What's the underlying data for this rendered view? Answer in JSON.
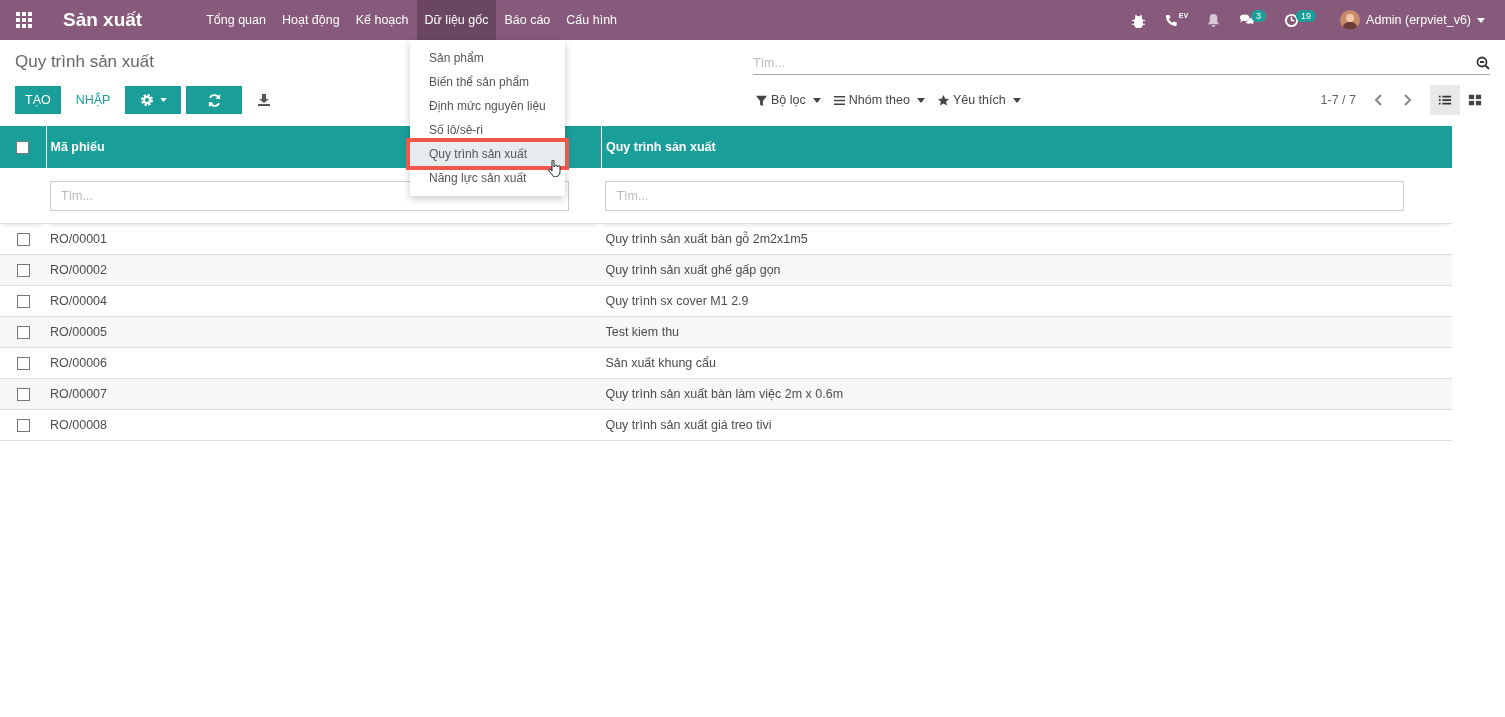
{
  "navbar": {
    "app_title": "Sản xuất",
    "menu": [
      {
        "label": "Tổng quan",
        "selected": false
      },
      {
        "label": "Hoạt động",
        "selected": false
      },
      {
        "label": "Kế hoạch",
        "selected": false
      },
      {
        "label": "Dữ liệu gốc",
        "selected": true
      },
      {
        "label": "Báo cáo",
        "selected": false
      },
      {
        "label": "Cấu hình",
        "selected": false
      }
    ],
    "systray": [
      {
        "kind": "bug"
      },
      {
        "kind": "phone",
        "tag": "EV"
      },
      {
        "kind": "bell"
      },
      {
        "kind": "chat",
        "badge": "3"
      },
      {
        "kind": "clock",
        "badge": "19"
      }
    ],
    "user": "Admin (erpviet_v6)"
  },
  "dropdown": {
    "items": [
      {
        "label": "Sản phẩm",
        "selected": false
      },
      {
        "label": "Biến thể sản phẩm",
        "selected": false
      },
      {
        "label": "Định mức nguyên liệu",
        "selected": false
      },
      {
        "label": "Số lô/sê-ri",
        "selected": false
      },
      {
        "label": "Quy trình sản xuất",
        "selected": true
      },
      {
        "label": "Năng lực sản xuất",
        "selected": false
      }
    ]
  },
  "control_panel": {
    "title": "Quy trình sản xuất",
    "create": "TẠO",
    "import": "NHẬP",
    "search_placeholder": "Tìm...",
    "filters": [
      {
        "kind": "filter",
        "label": "Bộ lọc"
      },
      {
        "kind": "group",
        "label": "Nhóm theo"
      },
      {
        "kind": "favorite",
        "label": "Yêu thích"
      }
    ],
    "pager": "1-7 / 7",
    "views": [
      {
        "kind": "list",
        "selected": true
      },
      {
        "kind": "kanban",
        "selected": false
      }
    ]
  },
  "table": {
    "select_all": false,
    "columns": [
      {
        "label": "Mã phiếu",
        "placeholder": "Tìm..."
      },
      {
        "label": "Quy trình sản xuất",
        "placeholder": "Tìm..."
      }
    ],
    "rows": [
      {
        "code": "RO/00001",
        "name": "Quy trình sản xuất bàn gỗ 2m2x1m5",
        "checked": false
      },
      {
        "code": "RO/00002",
        "name": "Quy trình sản xuất ghế gấp gọn",
        "checked": false
      },
      {
        "code": "RO/00004",
        "name": "Quy trình sx cover M1 2.9",
        "checked": false
      },
      {
        "code": "RO/00005",
        "name": "Test kiem thu",
        "checked": false
      },
      {
        "code": "RO/00006",
        "name": "Sản xuất khung cẩu",
        "checked": false
      },
      {
        "code": "RO/00007",
        "name": "Quy trình sản xuất bàn làm việc 2m x 0.6m",
        "checked": false
      },
      {
        "code": "RO/00008",
        "name": "Quy trình sản xuất giá treo tivi",
        "checked": false
      }
    ]
  }
}
